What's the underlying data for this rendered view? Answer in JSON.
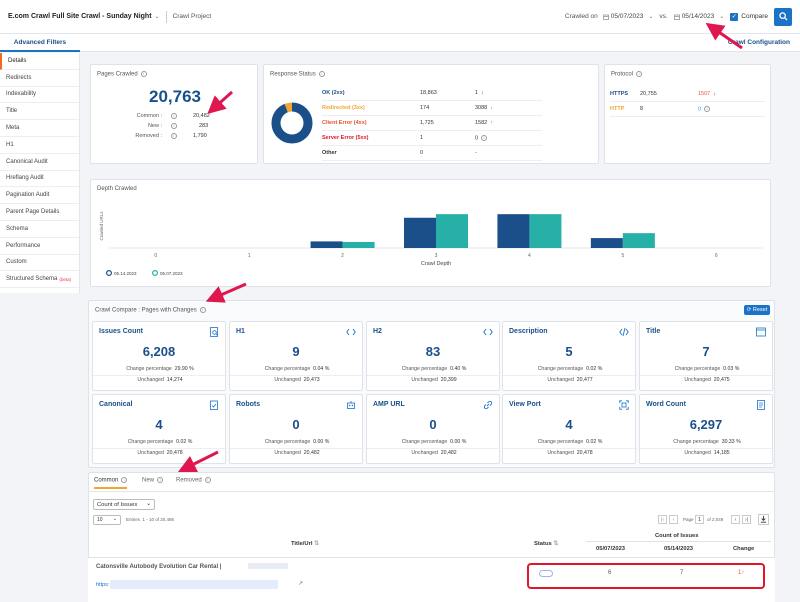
{
  "header": {
    "project_title": "E.com Crawl Full Site Crawl - Sunday Night",
    "project_type": "Crawl Project",
    "crawled_on_label": "Crawled on",
    "date_a": "05/07/2023",
    "vs_label": "vs.",
    "date_b": "05/14/2023",
    "compare_label": "Compare"
  },
  "tabs": {
    "advanced_filters": "Advanced Filters",
    "crawl_configuration": "Crawl Configuration"
  },
  "sidebar": {
    "items": [
      {
        "label": "Details"
      },
      {
        "label": "Redirects"
      },
      {
        "label": "Indexability"
      },
      {
        "label": "Title"
      },
      {
        "label": "Meta"
      },
      {
        "label": "H1"
      },
      {
        "label": "Canonical Audit"
      },
      {
        "label": "Hreflang Audit"
      },
      {
        "label": "Pagination Audit"
      },
      {
        "label": "Parent Page Details"
      },
      {
        "label": "Schema"
      },
      {
        "label": "Performance"
      },
      {
        "label": "Custom"
      },
      {
        "label": "Structured Schema",
        "badge": "(beta)"
      }
    ]
  },
  "pages_crawled": {
    "title": "Pages Crawled",
    "total": "20,763",
    "common_label": "Common :",
    "common_value": "20,482",
    "new_label": "New :",
    "new_value": "283",
    "removed_label": "Removed :",
    "removed_value": "1,790"
  },
  "response_status": {
    "title": "Response Status",
    "donut": {
      "ok_fraction": 0.94,
      "redirect_fraction": 0.06,
      "ok_color": "#1a4f8a",
      "redirect_color": "#f2a533"
    },
    "rows": [
      {
        "name": "OK (2xx)",
        "v1": "18,863",
        "v2": "1",
        "trend": "down",
        "name_color": "#1a4f8a"
      },
      {
        "name": "Redirected (3xx)",
        "v1": "174",
        "v2": "3088",
        "trend": "down",
        "name_color": "#f2a533"
      },
      {
        "name": "Client Error (4xx)",
        "v1": "1,725",
        "v2": "1582",
        "trend": "up",
        "name_color": "#e8532b"
      },
      {
        "name": "Server Error (5xx)",
        "v1": "1",
        "v2": "0",
        "trend": "info",
        "name_color": "#e0172b"
      },
      {
        "name": "Other",
        "v1": "0",
        "v2": "-",
        "trend": "",
        "name_color": "#333333"
      }
    ]
  },
  "protocol": {
    "title": "Protocol",
    "rows": [
      {
        "name": "HTTPS",
        "v1": "20,755",
        "v2": "1507",
        "trend": "down",
        "name_color": "#1a4f8a"
      },
      {
        "name": "HTTP",
        "v1": "8",
        "v2": "0",
        "trend": "info",
        "name_color": "#f2a533"
      }
    ]
  },
  "depth_crawled": {
    "title": "Depth Crawled",
    "chart_data": {
      "type": "bar",
      "categories": [
        "0",
        "1",
        "2",
        "3",
        "4",
        "5",
        "6"
      ],
      "series": [
        {
          "name": "05.14.2023",
          "color": "#1a4f8a",
          "values": [
            0,
            0,
            240,
            1100,
            1230,
            360,
            0
          ]
        },
        {
          "name": "05.07.2023",
          "color": "#26b0a8",
          "values": [
            0,
            0,
            220,
            1230,
            1230,
            540,
            0
          ]
        }
      ],
      "title": "Depth Crawled",
      "xlabel": "Crawl Depth",
      "ylabel": "Crawled URLs",
      "ylim": [
        0,
        1600
      ],
      "grid": false,
      "legend": "bottom-left"
    }
  },
  "crawl_compare": {
    "title": "Crawl Compare : Pages with Changes",
    "reset_label": "Reset",
    "cards": [
      {
        "title": "Issues Count",
        "icon": "search-doc-icon",
        "value": "6,208",
        "change_label": "Change percentage",
        "change": "29.90 %",
        "unchanged_label": "Unchanged",
        "unchanged": "14,274"
      },
      {
        "title": "H1",
        "icon": "code-tag-icon",
        "value": "9",
        "change_label": "Change percentage",
        "change": "0.04 %",
        "unchanged_label": "Unchanged",
        "unchanged": "20,473"
      },
      {
        "title": "H2",
        "icon": "code-tag-icon",
        "value": "83",
        "change_label": "Change percentage",
        "change": "0.40 %",
        "unchanged_label": "Unchanged",
        "unchanged": "20,399"
      },
      {
        "title": "Description",
        "icon": "code-slash-icon",
        "value": "5",
        "change_label": "Change percentage",
        "change": "0.02 %",
        "unchanged_label": "Unchanged",
        "unchanged": "20,477"
      },
      {
        "title": "Title",
        "icon": "browser-window-icon",
        "value": "7",
        "change_label": "Change percentage",
        "change": "0.03 %",
        "unchanged_label": "Unchanged",
        "unchanged": "20,475"
      },
      {
        "title": "Canonical",
        "icon": "clipboard-check-icon",
        "value": "4",
        "change_label": "Change percentage",
        "change": "0.02 %",
        "unchanged_label": "Unchanged",
        "unchanged": "20,478"
      },
      {
        "title": "Robots",
        "icon": "robot-icon",
        "value": "0",
        "change_label": "Change percentage",
        "change": "0.00 %",
        "unchanged_label": "Unchanged",
        "unchanged": "20,482"
      },
      {
        "title": "AMP URL",
        "icon": "link-icon",
        "value": "0",
        "change_label": "Change percentage",
        "change": "0.00 %",
        "unchanged_label": "Unchanged",
        "unchanged": "20,482"
      },
      {
        "title": "View Port",
        "icon": "viewport-icon",
        "value": "4",
        "change_label": "Change percentage",
        "change": "0.02 %",
        "unchanged_label": "Unchanged",
        "unchanged": "20,478"
      },
      {
        "title": "Word Count",
        "icon": "document-icon",
        "value": "6,297",
        "change_label": "Change percentage",
        "change": "30.33 %",
        "unchanged_label": "Unchanged",
        "unchanged": "14,185"
      }
    ]
  },
  "bottom": {
    "tabs": [
      "Common",
      "New",
      "Removed"
    ],
    "filter_select": "Count of Issues",
    "page_size": "10",
    "entries_label": "Entries",
    "entries_range": "1 - 10 of 20,486",
    "page_label": "Page",
    "page_number": "1",
    "page_total": "of 2,049",
    "col_title_url": "Title/Url",
    "col_status": "Status",
    "col_count_issues": "Count of Issues",
    "col_date_a": "05/07/2023",
    "col_date_b": "05/14/2023",
    "col_change": "Change",
    "row": {
      "title": "Catonsville Autobody Evolution Car Rental |",
      "url_prefix": "https:",
      "count_a": "6",
      "count_b": "7",
      "change": "1"
    }
  },
  "colors": {
    "accent": "#1a73c7",
    "brand": "#1a4f8a",
    "annotation": "#e0174f"
  }
}
